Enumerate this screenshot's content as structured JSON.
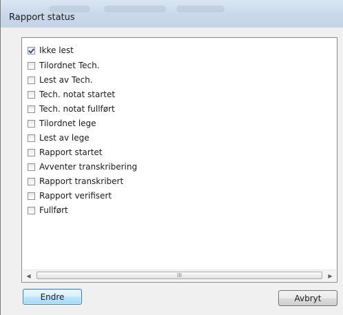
{
  "dialog": {
    "title": "Rapport status"
  },
  "status_list": {
    "items": [
      {
        "label": "Ikke lest",
        "checked": true
      },
      {
        "label": "Tilordnet Tech.",
        "checked": false
      },
      {
        "label": "Lest av Tech.",
        "checked": false
      },
      {
        "label": "Tech. notat startet",
        "checked": false
      },
      {
        "label": "Tech. notat fullført",
        "checked": false
      },
      {
        "label": "Tilordnet lege",
        "checked": false
      },
      {
        "label": "Lest av lege",
        "checked": false
      },
      {
        "label": "Rapport startet",
        "checked": false
      },
      {
        "label": "Avventer transkribering",
        "checked": false
      },
      {
        "label": "Rapport transkribert",
        "checked": false
      },
      {
        "label": "Rapport verifisert",
        "checked": false
      },
      {
        "label": "Fullført",
        "checked": false
      }
    ],
    "scrollbar_grip": "III"
  },
  "buttons": {
    "change_label": "Endre",
    "cancel_label": "Avbryt"
  },
  "icons": {
    "scroll_left": "left-arrow-icon",
    "scroll_right": "right-arrow-icon"
  }
}
